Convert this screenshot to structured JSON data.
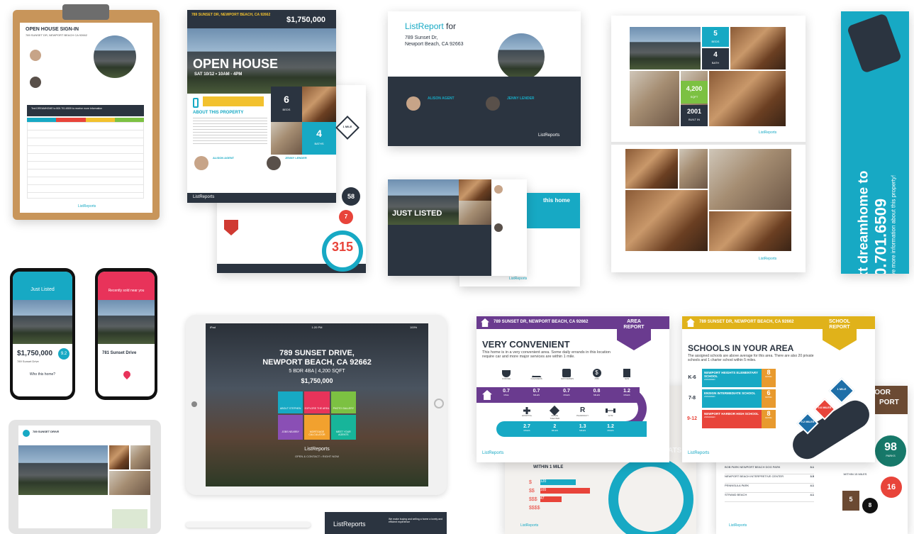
{
  "clipboard": {
    "title": "OPEN HOUSE SIGN-IN",
    "address": "789 SUNSET DR, NEWPORT BEACH CA 92662",
    "banner": "Text DREAMHOME to 800.701.6509 to receive more information",
    "footer": "ListReports"
  },
  "flyer": {
    "address": "789 SUNSET DR, NEWPORT BEACH, CA 92662",
    "price": "$1,750,000",
    "headline": "OPEN HOUSE",
    "date": "SAT 10/12 • 10AM - 4PM",
    "about": "ABOUT THIS PROPERTY",
    "beds": "6",
    "beds_label": "BEDS",
    "baths": "4",
    "baths_label": "BATHS",
    "agent1": "ALISON AGENT",
    "agent2": "JENNY LENDER",
    "logo": "ListReports",
    "school_score": "315",
    "score_58": "58",
    "score_7": "7",
    "miles": "1 MILE"
  },
  "agent_card": {
    "brand": "ListReport",
    "for": "for",
    "address_line1": "789 Sunset Dr,",
    "address_line2": "Newport Beach, CA 92663",
    "agent1": "ALISON AGENT",
    "agent2": "JENNY LENDER",
    "logo": "ListReports"
  },
  "just_listed": {
    "headline": "JUST LISTED",
    "teaser": "this home",
    "logo": "ListReports"
  },
  "gallery": {
    "beds": "5",
    "beds_label": "BEDS",
    "baths": "4",
    "baths_label": "BATH",
    "sqft": "4,200",
    "sqft_label": "SQFT",
    "year": "2001",
    "year_label": "BUILT IN",
    "logo": "ListReports"
  },
  "text_banner": {
    "line1": "Text dreamhome to",
    "phone": "800.701.6509",
    "line3": "to receive more information about this property!"
  },
  "phones": {
    "left_title": "Just Listed",
    "left_price": "$1,750,000",
    "left_address": "789 Sunset Drive",
    "left_question": "Who this home?",
    "left_badge": "9.2",
    "right_title": "Recently sold near you",
    "right_address": "781 Sunset Drive"
  },
  "tablet_small": {
    "address": "789 SUNSET DRIVE"
  },
  "ipad": {
    "status_left": "iPad",
    "status_time": "1:20 PM",
    "status_right": "100%",
    "address_line1": "789 SUNSET DRIVE,",
    "address_line2": "NEWPORT BEACH, CA 92662",
    "details": "5 BDR 4BA | 4,200 SQFT",
    "price": "$1,750,000",
    "tiles": [
      "ABOUT STEPHEN",
      "EXPLORE THE AREA",
      "PHOTO GALLERY",
      "JOBS NEARBY",
      "MORTGAGE CALCULATOR",
      "MEET YOUR AGENTS"
    ],
    "logo": "ListReports",
    "tagline": "OPEN & CONTACT • RIGHT NOW"
  },
  "business_card": {
    "logo": "ListReports",
    "text": "We make buying and selling a home a lovely and efficient experience"
  },
  "area_report": {
    "address": "789 SUNSET DR, NEWPORT BEACH, CA 92662",
    "tag1": "AREA",
    "tag2": "REPORT",
    "headline": "VERY CONVENIENT",
    "body": "This home is in a very convenient area. Some daily errands in this location require car and more major services are within 1 mile.",
    "row1_labels": [
      "COFFEE",
      "CLEANERS",
      "GROCERIES",
      "ATM",
      "GAS"
    ],
    "row1_values": [
      "0.7",
      "0.7",
      "0.7",
      "0.8",
      "1.2"
    ],
    "row1_units": [
      "MILE",
      "MILES",
      "MILES",
      "MILES",
      "MILES"
    ],
    "row2_labels": [
      "HOSPITAL",
      "MOVIE THEATER",
      "PHARMACY",
      "GYM"
    ],
    "row2_values": [
      "2.7",
      "2",
      "1.3",
      "1.2"
    ],
    "row2_units": [
      "MILES",
      "MILES",
      "MILES",
      "MILES"
    ],
    "logo": "ListReports",
    "cost_rows": [
      "$",
      "$$",
      "$$$",
      "$$$$"
    ],
    "cost_values": [
      "120",
      "165",
      "47"
    ],
    "within": "WITHIN 1 MILE",
    "cats_fragment": "ATS"
  },
  "school_report": {
    "address": "789 SUNSET DR, NEWPORT BEACH, CA 92662",
    "tag1": "SCHOOL",
    "tag2": "REPORT",
    "headline": "SCHOOLS IN YOUR AREA",
    "body": "The assigned schools are above average for this area. There are also 20 private schools and 1 charter school within 5 miles.",
    "schools": [
      {
        "grades": "K-6",
        "name": "NEWPORT HEIGHTS ELEMENTARY SCHOOL",
        "sub": "ASSIGNED",
        "rating": "8",
        "rating_label": "RATING"
      },
      {
        "grades": "7-8",
        "name": "ENSIGN INTERMEDIATE SCHOOL",
        "sub": "ASSIGNED",
        "rating": "6",
        "rating_label": "RATING"
      },
      {
        "grades": "9-12",
        "name": "NEWPORT HARBOR HIGH SCHOOL",
        "sub": "ASSIGNED",
        "rating": "8",
        "rating_label": "RATING"
      }
    ],
    "signs": [
      "1 MILE",
      "0.6 MILES",
      "0.2 MILES"
    ],
    "logo": "ListReports",
    "door_fragment": "DOOR",
    "port_fragment": "PORT",
    "score_98": "98",
    "score_98_label": "PARKS",
    "score_16": "16",
    "score_5": "5",
    "score_8": "8",
    "within": "WITHIN 15 MILES",
    "parks": [
      {
        "name": "BOB PARK NEWPORT BEACH DOG PARK",
        "dist": "3.1"
      },
      {
        "name": "NEWPORT BEACH INTERPRETIVE CENTER",
        "dist": "3.5"
      },
      {
        "name": "PENINSULA PARK",
        "dist": "4.1"
      },
      {
        "name": "STRAND BEACH",
        "dist": "4.1"
      }
    ]
  }
}
